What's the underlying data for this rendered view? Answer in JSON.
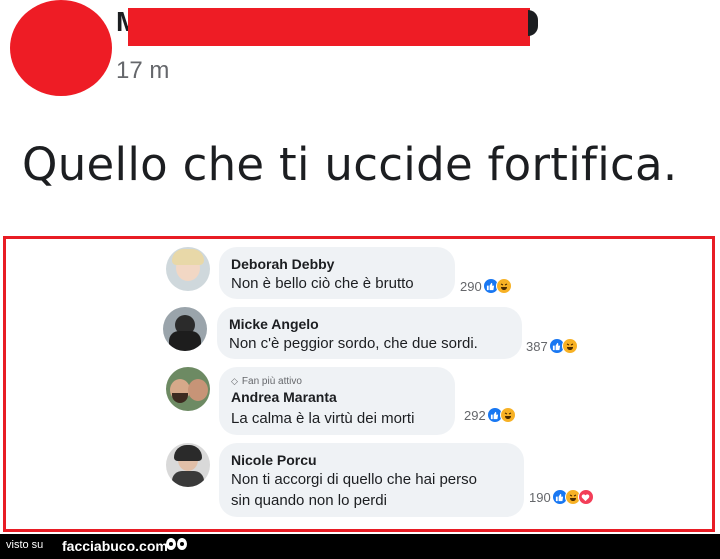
{
  "post": {
    "author_initial": "M",
    "time": "17 m",
    "text": "Quello che ti uccide fortifica."
  },
  "comments": [
    {
      "author": "Deborah Debby",
      "text": "Non è bello ciò che è brutto",
      "count": "290",
      "reactions": [
        "like-icon",
        "haha-icon"
      ]
    },
    {
      "author": "Micke Angelo",
      "text": "Non c'è peggior sordo, che due sordi.",
      "count": "387",
      "reactions": [
        "like-icon",
        "haha-icon"
      ]
    },
    {
      "badge": "Fan più attivo",
      "author": "Andrea Maranta",
      "text": "La calma è la virtù dei morti",
      "count": "292",
      "reactions": [
        "like-icon",
        "haha-icon"
      ]
    },
    {
      "author": "Nicole Porcu",
      "text_line1": "Non ti accorgi di quello che hai perso",
      "text_line2": "sin quando non lo perdi",
      "count": "190",
      "reactions": [
        "like-icon",
        "haha-icon",
        "love-icon"
      ]
    }
  ],
  "footer": {
    "prefix": "visto su",
    "brand": "facciabuco.com"
  },
  "colors": {
    "redaction": "#ee1c25",
    "frame": "#e81c24",
    "bubble": "#eff2f5",
    "like": "#1877f2",
    "haha": "#f7b125",
    "love": "#f33e58"
  }
}
